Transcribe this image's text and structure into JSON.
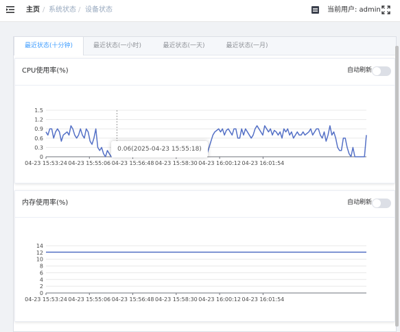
{
  "header": {
    "breadcrumbs": [
      "主页",
      "系统状态",
      "设备状态"
    ],
    "separator": "/",
    "user_label": "当前用户: admin",
    "icons": [
      "menu-fold-icon",
      "user-card-icon",
      "fullscreen-icon"
    ]
  },
  "tabs": [
    {
      "label": "最近状态(十分钟)",
      "active": true
    },
    {
      "label": "最近状态(一小时)",
      "active": false
    },
    {
      "label": "最近状态(一天)",
      "active": false
    },
    {
      "label": "最近状态(一月)",
      "active": false
    }
  ],
  "colors": {
    "accent": "#409eff",
    "line": "#5470c6",
    "switch_off": "#dcdfe6"
  },
  "cpu_panel": {
    "title": "CPU使用率(%)",
    "auto_refresh_label": "自动刷新",
    "auto_refresh": false
  },
  "mem_panel": {
    "title": "内存使用率(%)",
    "auto_refresh_label": "自动刷新",
    "auto_refresh": false
  },
  "tooltip": {
    "text": "0.06(2025-04-23 15:55:18)"
  },
  "chart_data": [
    {
      "type": "line",
      "title": "CPU使用率(%)",
      "xlim": [
        "2025-04-23 15:53:24",
        "2025-04-23 16:03:26"
      ],
      "x_tick_labels": [
        "04-23 15:53:24",
        "04-23 15:55:06",
        "04-23 15:56:48",
        "04-23 15:58:30",
        "04-23 16:00:12",
        "04-23 16:01:54"
      ],
      "y_tick_labels": [
        "0",
        "0.3",
        "0.6",
        "0.9",
        "1.2",
        "1.5"
      ],
      "ylim": [
        0,
        1.5
      ],
      "grid": true,
      "series": [
        {
          "values": [
            0.8,
            0.7,
            0.9,
            0.9,
            0.6,
            0.8,
            0.9,
            0.8,
            0.5,
            0.7,
            0.75,
            0.8,
            0.7,
            1.0,
            0.9,
            0.7,
            0.6,
            0.7,
            0.9,
            0.7,
            0.6,
            0.9,
            0.8,
            0.5,
            0.4,
            0.6,
            0.9,
            0.3,
            0.2,
            0.3,
            0.1,
            0.0,
            0.2,
            0.1,
            0.0,
            0.3,
            0.1,
            0.0,
            0.06,
            0.1,
            0.0,
            0.0,
            0.05,
            0.0,
            0.0,
            0.0,
            0.0,
            0.0,
            0.0,
            0.0,
            0.0,
            0.0,
            0.0,
            0.0,
            0.0,
            0.0,
            0.0,
            0.0,
            0.0,
            0.0,
            0.0,
            0.0,
            0.0,
            0.0,
            0.0,
            0.0,
            0.0,
            0.0,
            0.0,
            0.0,
            0.0,
            0.0,
            0.0,
            0.0,
            0.0,
            0.0,
            0.0,
            0.0,
            0.0,
            0.0,
            0.0,
            0.0,
            0.0,
            0.0,
            0.1,
            0.3,
            0.5,
            0.7,
            0.8,
            0.85,
            0.9,
            0.8,
            0.9,
            0.7,
            0.85,
            0.9,
            0.8,
            0.7,
            0.9,
            0.9,
            0.6,
            0.6,
            0.9,
            0.7,
            0.9,
            0.8,
            0.7,
            0.6,
            0.7,
            0.9,
            1.0,
            0.9,
            0.8,
            0.7,
            1.0,
            0.9,
            0.8,
            0.9,
            0.7,
            0.85,
            0.8,
            0.7,
            0.8,
            0.6,
            0.9,
            0.8,
            0.9,
            0.7,
            0.8,
            0.6,
            0.7,
            0.8,
            0.7,
            0.7,
            0.8,
            0.7,
            0.75,
            0.8,
            0.9,
            0.7,
            0.8,
            0.9,
            0.9,
            0.7,
            0.6,
            0.8,
            0.5,
            0.7,
            1.0,
            0.7,
            0.8,
            0.6,
            0.3,
            0.2,
            0.2,
            0.6,
            0.6,
            0.3,
            0.1,
            0.0,
            0.3,
            0.0,
            0.0,
            0.0,
            0.0,
            0.0,
            0.0,
            0.7
          ]
        }
      ]
    },
    {
      "type": "line",
      "title": "内存使用率(%)",
      "xlim": [
        "2025-04-23 15:53:24",
        "2025-04-23 16:03:26"
      ],
      "x_tick_labels": [
        "04-23 15:53:24",
        "04-23 15:55:06",
        "04-23 15:56:48",
        "04-23 15:58:30",
        "04-23 16:00:12",
        "04-23 16:01:54"
      ],
      "y_tick_labels": [
        "0",
        "2",
        "4",
        "6",
        "8",
        "10",
        "12",
        "14"
      ],
      "ylim": [
        0,
        14
      ],
      "grid": true,
      "series": [
        {
          "values": [
            12.1,
            12.1,
            12.1,
            12.1,
            12.1,
            12.1,
            12.1,
            12.1,
            12.1,
            12.1,
            12.1,
            12.1,
            12.1,
            12.1,
            12.1,
            12.1,
            12.1,
            12.1,
            12.1,
            12.1,
            12.1,
            12.1,
            12.1,
            12.1,
            12.1,
            12.1,
            12.1,
            12.1,
            12.1,
            12.1,
            12.1,
            12.1,
            12.1,
            12.1,
            12.1,
            12.1,
            12.1,
            12.1,
            12.1,
            12.1,
            12.1,
            12.1,
            12.1,
            12.1,
            12.1,
            12.1,
            12.1,
            12.1,
            12.1,
            12.1,
            12.1,
            12.1,
            12.1,
            12.1,
            12.1,
            12.1,
            12.1,
            12.1,
            12.1,
            12.1
          ]
        }
      ]
    }
  ]
}
